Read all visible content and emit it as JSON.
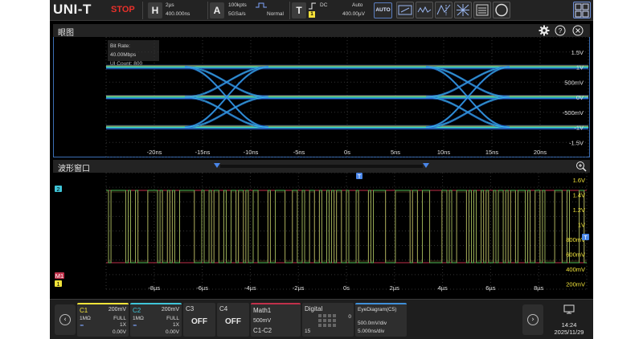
{
  "toolbar": {
    "logo": "UNI-T",
    "run_state": "STOP",
    "horizontal": {
      "key": "H",
      "timebase": "2µs",
      "delay": "400.000ns"
    },
    "acquire": {
      "key": "A",
      "memory_depth": "100kpts",
      "sample_rate": "5GSa/s",
      "mode": "Normal"
    },
    "trigger": {
      "key": "T",
      "source_badge": "1",
      "coupling": "DC",
      "sweep": "Auto",
      "level": "400.00µV"
    },
    "auto_label": "AUTO",
    "icons": [
      "measure-icon",
      "math-fft-icon",
      "cursor-icon",
      "grid-display-icon",
      "search-icon",
      "multi-window-icon"
    ]
  },
  "eye_window": {
    "title": "眼图",
    "info": {
      "bit_rate": "Bit Rate: 40.00Mbps",
      "ui_count": "UI Count: 800"
    },
    "y_ticks": [
      "1.5V",
      "1V",
      "500mV",
      "0V",
      "-500mV",
      "-1V",
      "-1.5V"
    ],
    "x_ticks": [
      "-20ns",
      "-15ns",
      "-10ns",
      "-5ns",
      "0s",
      "5ns",
      "10ns",
      "15ns",
      "20ns"
    ]
  },
  "wave_window": {
    "title": "波形窗口",
    "y_ticks": [
      "1.6V",
      "1.4V",
      "1.2V",
      "1V",
      "800mV",
      "600mV",
      "400mV",
      "200mV"
    ],
    "x_ticks": [
      "-8µs",
      "-6µs",
      "-4µs",
      "-2µs",
      "0s",
      "2µs",
      "4µs",
      "6µs",
      "8µs"
    ],
    "ch2_marker": "2",
    "math_marker": "M1",
    "trigger_marker": "T",
    "ch1_marker": "1",
    "right_marker": "T"
  },
  "channels": [
    {
      "name": "C1",
      "scale": "200mV",
      "impedance": "1MΩ",
      "bandwidth": "FULL",
      "probe": "1X",
      "offset": "0.00V",
      "color": "#f2e43a"
    },
    {
      "name": "C2",
      "scale": "200mV",
      "impedance": "1MΩ",
      "bandwidth": "FULL",
      "probe": "1X",
      "offset": "0.00V",
      "color": "#3fc5d8"
    },
    {
      "name": "C3",
      "state": "OFF"
    },
    {
      "name": "C4",
      "state": "OFF"
    }
  ],
  "math": {
    "name": "Math1",
    "scale": "500mV",
    "expr": "C1-C2",
    "color": "#c0304a"
  },
  "digital": {
    "name": "Digital",
    "value": "0",
    "index": "15"
  },
  "eye_diagram": {
    "name": "EyeDiagram(C5)",
    "vdiv": "500.0mV/div",
    "tdiv": "5.000ns/div"
  },
  "clock": {
    "time": "14:24",
    "date": "2025/11/29"
  }
}
